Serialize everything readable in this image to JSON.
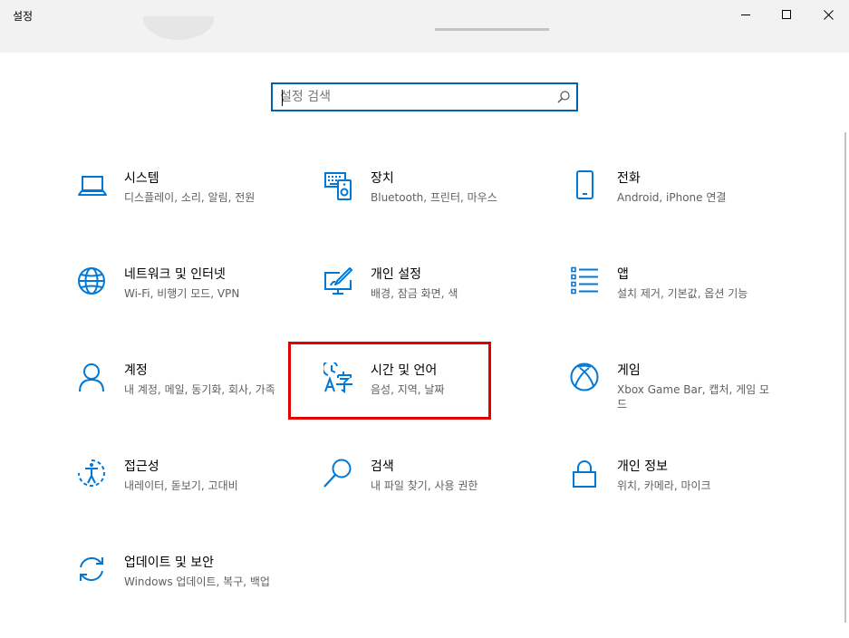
{
  "window": {
    "title": "설정"
  },
  "search": {
    "placeholder": "설정 검색",
    "value": ""
  },
  "colors": {
    "accent": "#0078d7",
    "highlight": "#e00000"
  },
  "tiles": [
    {
      "name": "시스템",
      "desc": "디스플레이, 소리, 알림, 전원",
      "icon": "laptop-icon"
    },
    {
      "name": "장치",
      "desc": "Bluetooth, 프린터, 마우스",
      "icon": "devices-icon"
    },
    {
      "name": "전화",
      "desc": "Android, iPhone 연결",
      "icon": "phone-icon"
    },
    {
      "name": "네트워크 및 인터넷",
      "desc": "Wi-Fi, 비행기 모드, VPN",
      "icon": "globe-icon"
    },
    {
      "name": "개인 설정",
      "desc": "배경, 잠금 화면, 색",
      "icon": "personalization-icon"
    },
    {
      "name": "앱",
      "desc": "설치 제거, 기본값, 옵션 기능",
      "icon": "apps-list-icon"
    },
    {
      "name": "계정",
      "desc": "내 계정, 메일, 동기화, 회사, 가족",
      "icon": "person-icon"
    },
    {
      "name": "시간 및 언어",
      "desc": "음성, 지역, 날짜",
      "icon": "time-language-icon"
    },
    {
      "name": "게임",
      "desc": "Xbox Game Bar, 캡처, 게임 모드",
      "icon": "xbox-icon"
    },
    {
      "name": "접근성",
      "desc": "내레이터, 돋보기, 고대비",
      "icon": "ease-of-access-icon"
    },
    {
      "name": "검색",
      "desc": "내 파일 찾기, 사용 권한",
      "icon": "search-icon"
    },
    {
      "name": "개인 정보",
      "desc": "위치, 카메라, 마이크",
      "icon": "lock-icon"
    },
    {
      "name": "업데이트 및 보안",
      "desc": "Windows 업데이트, 복구, 백업",
      "icon": "update-icon"
    }
  ]
}
